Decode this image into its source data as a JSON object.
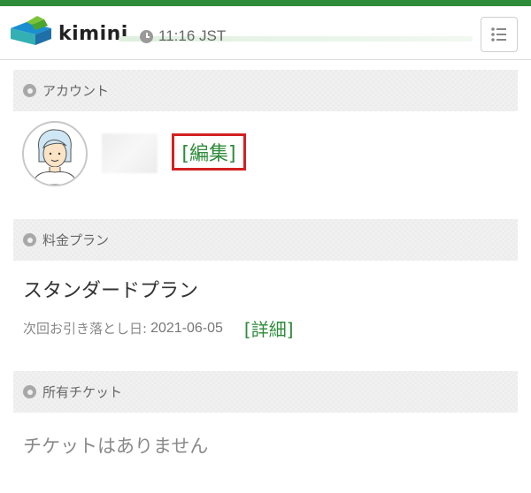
{
  "header": {
    "brand": "kimini",
    "time": "11:16 JST",
    "icons": {
      "logo": "kimini-logo",
      "clock": "clock-icon",
      "menu": "list-menu-icon"
    },
    "colors": {
      "brand_green": "#2e8b3a",
      "logo_blue": "#1a8fd0",
      "logo_teal": "#34b0b4"
    }
  },
  "account": {
    "title": "アカウント",
    "edit_label": "[編集]",
    "highlight_color": "#d32020"
  },
  "plan": {
    "title": "料金プラン",
    "name": "スタンダードプラン",
    "next_debit_label": "次回お引き落とし日:",
    "next_debit_date": "2021-06-05",
    "detail_label": "[詳細]"
  },
  "tickets": {
    "title": "所有チケット",
    "empty_text": "チケットはありません"
  }
}
